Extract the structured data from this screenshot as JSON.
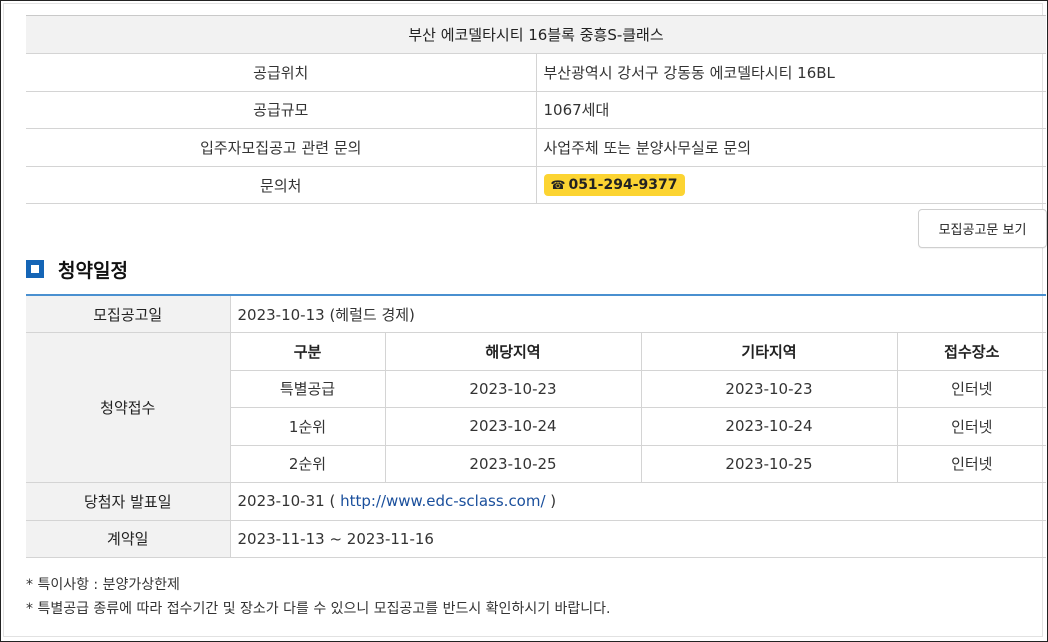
{
  "info": {
    "title": "부산 에코델타시티 16블록 중흥S-클래스",
    "rows": [
      {
        "label": "공급위치",
        "value": "부산광역시 강서구 강동동 에코델타시티 16BL"
      },
      {
        "label": "공급규모",
        "value": "1067세대"
      },
      {
        "label": "입주자모집공고 관련 문의",
        "value": "사업주체 또는 분양사무실로 문의"
      }
    ],
    "contact_label": "문의처",
    "phone_icon": "☎",
    "phone": "051-294-9377"
  },
  "notice_button": "모집공고문 보기",
  "section_title": "청약일정",
  "schedule": {
    "announce_label": "모집공고일",
    "announce_value": "2023-10-13 (헤럴드 경제)",
    "apply_label": "청약접수",
    "headers": [
      "구분",
      "해당지역",
      "기타지역",
      "접수장소"
    ],
    "rows": [
      [
        "특별공급",
        "2023-10-23",
        "2023-10-23",
        "인터넷"
      ],
      [
        "1순위",
        "2023-10-24",
        "2023-10-24",
        "인터넷"
      ],
      [
        "2순위",
        "2023-10-25",
        "2023-10-25",
        "인터넷"
      ]
    ],
    "winner_label": "당첨자 발표일",
    "winner_date": "2023-10-31 ( ",
    "winner_link": "http://www.edc-sclass.com/",
    "winner_close": " )",
    "contract_label": "계약일",
    "contract_value": "2023-11-13 ~ 2023-11-16"
  },
  "notes": [
    "* 특이사항 : 분양가상한제",
    "* 특별공급 종류에 따라 접수기간 및 장소가 다를 수 있으니 모집공고를 반드시 확인하시기 바랍니다."
  ]
}
